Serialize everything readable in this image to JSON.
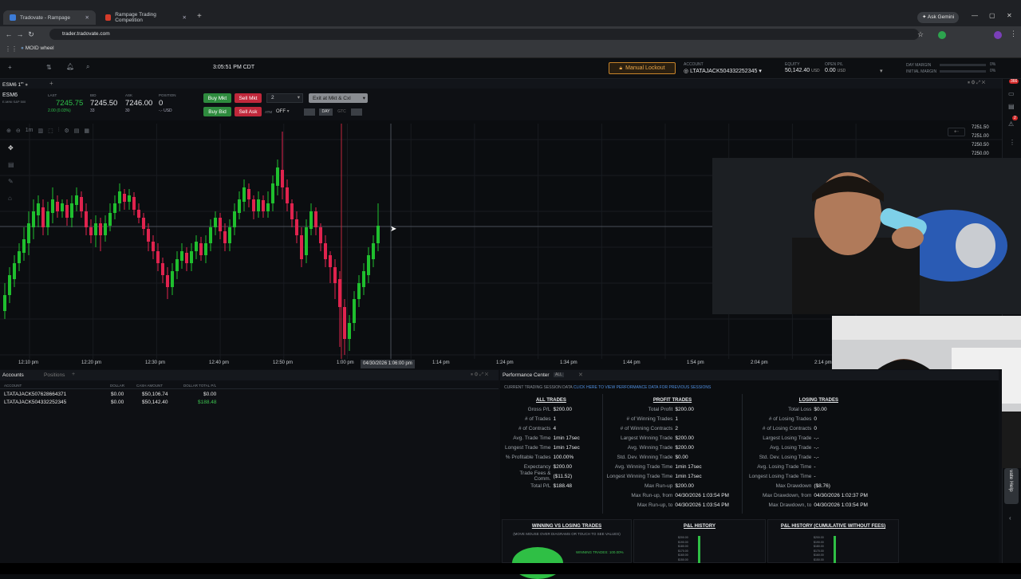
{
  "browser": {
    "tabs": [
      {
        "title": "Tradovate - Rampage",
        "active": true
      },
      {
        "title": "Rampage Trading Competition",
        "active": false
      }
    ],
    "new_tab": "+",
    "ask_gemini": "Ask Gemini",
    "url": "trader.tradovate.com",
    "bookmark": "MOID wheel"
  },
  "app": {
    "time": "3:05:51 PM CDT",
    "manual_lockout": "Manual Lockout",
    "account_label": "ACCOUNT",
    "account_value": "LTATAJACK504332252345",
    "equity_label": "EQUITY",
    "equity_value": "50,142.40",
    "equity_unit": "USD",
    "open_pl_label": "OPEN P/L",
    "open_pl_value": "0.00",
    "open_pl_unit": "USD",
    "day_margin_label": "DAY MARGIN",
    "initial_margin_label": "INITIAL MARGIN",
    "day_margin_pct": "0%",
    "initial_margin_pct": "0%",
    "notif_count": "366",
    "notif_count2": "2"
  },
  "symbol_tab": "ESM6 1",
  "quote": {
    "symbol": "ESM6",
    "desc": "E-MINI S&P 500",
    "last_label": "LAST",
    "last": "7245.75",
    "change": "2.00 (0.03%)",
    "bid_label": "BID",
    "bid": "7245.50",
    "bid_size": "33",
    "ask_label": "ASK",
    "ask": "7246.00",
    "ask_size": "30",
    "position_label": "POSITION",
    "position": "0",
    "position_sub": "-.- USD"
  },
  "order": {
    "buy_mkt": "Buy Mkt",
    "sell_mkt": "Sell Mkt",
    "qty": "2",
    "exit": "Exit at Mkt & Cxl",
    "buy_bid": "Buy Bid",
    "sell_ask": "Sell Ask",
    "atm_label": "ATM",
    "atm_value": "OFF",
    "day": "DAY",
    "gtc": "GTC"
  },
  "chart": {
    "interval": "1m",
    "price_labels": [
      "7251.50",
      "7251.00",
      "7250.50",
      "7250.00"
    ],
    "time_labels": [
      "12:10 pm",
      "12:20 pm",
      "12:30 pm",
      "12:40 pm",
      "12:50 pm",
      "1:00 pm",
      "1:14 pm",
      "1:24 pm",
      "1:34 pm",
      "1:44 pm",
      "1:54 pm",
      "2:04 pm",
      "2:14 pm"
    ],
    "crosshair_time": "04/30/2026 1:06:00 pm",
    "colors": {
      "up": "#1fbf2e",
      "down": "#e0234e"
    }
  },
  "accounts": {
    "tabs": [
      "Accounts",
      "Positions"
    ],
    "headers": [
      "ACCOUNT",
      "DOLLAR",
      "CASH AMOUNT",
      "DOLLAR TOTAL P/L"
    ],
    "rows": [
      {
        "account": "LTATAJACK507628664371",
        "dollar": "$0.00",
        "cash": "$50,106.74",
        "pl": "$0.00"
      },
      {
        "account": "LTATAJACK504332252345",
        "dollar": "$0.00",
        "cash": "$50,142.40",
        "pl": "$188.48"
      }
    ]
  },
  "perf": {
    "title": "Performance Center",
    "badge": "ALL",
    "banner_a": "CURRENT TRADING SESSION DATA",
    "banner_b": "CLICK HERE TO VIEW PERFORMANCE DATA FOR PREVIOUS SESSIONS",
    "all_trades": {
      "title": "ALL TRADES",
      "rows": [
        {
          "k": "Gross P/L",
          "v": "$200.00"
        },
        {
          "k": "# of Trades",
          "v": "1"
        },
        {
          "k": "# of Contracts",
          "v": "4"
        },
        {
          "k": "Avg. Trade Time",
          "v": "1min 17sec"
        },
        {
          "k": "Longest Trade Time",
          "v": "1min 17sec"
        },
        {
          "k": "% Profitable Trades",
          "v": "100.00%"
        },
        {
          "k": "Expectancy",
          "v": "$200.00"
        },
        {
          "k": "Trade Fees & Comm.",
          "v": "($11.52)"
        },
        {
          "k": "Total P/L",
          "v": "$188.48"
        }
      ]
    },
    "profit_trades": {
      "title": "PROFIT TRADES",
      "rows": [
        {
          "k": "Total Profit",
          "v": "$200.00"
        },
        {
          "k": "# of Winning Trades",
          "v": "1"
        },
        {
          "k": "# of Winning Contracts",
          "v": "2"
        },
        {
          "k": "Largest Winning Trade",
          "v": "$200.00"
        },
        {
          "k": "Avg. Winning Trade",
          "v": "$200.00"
        },
        {
          "k": "Std. Dev. Winning Trade",
          "v": "$0.00"
        },
        {
          "k": "Avg. Winning Trade Time",
          "v": "1min 17sec"
        },
        {
          "k": "Longest Winning Trade Time",
          "v": "1min 17sec"
        },
        {
          "k": "Max Run-up",
          "v": "$200.00"
        },
        {
          "k": "Max Run-up, from",
          "v": "04/30/2026 1:03:54 PM"
        },
        {
          "k": "Max Run-up, to",
          "v": "04/30/2026 1:03:54 PM"
        }
      ]
    },
    "losing_trades": {
      "title": "LOSING TRADES",
      "rows": [
        {
          "k": "Total Loss",
          "v": "$0.00"
        },
        {
          "k": "# of Losing Trades",
          "v": "0"
        },
        {
          "k": "# of Losing Contracts",
          "v": "0"
        },
        {
          "k": "Largest Losing Trade",
          "v": "-.-"
        },
        {
          "k": "Avg. Losing Trade",
          "v": "-.-"
        },
        {
          "k": "Std. Dev. Losing Trade",
          "v": "-.-"
        },
        {
          "k": "Avg. Losing Trade Time",
          "v": "-"
        },
        {
          "k": "Longest Losing Trade Time",
          "v": "-"
        },
        {
          "k": "Max Drawdown",
          "v": "($8.76)"
        },
        {
          "k": "Max Drawdown, from",
          "v": "04/30/2026 1:02:37 PM"
        },
        {
          "k": "Max Drawdown, to",
          "v": "04/30/2026 1:03:54 PM"
        }
      ]
    },
    "win_vs_lose_title": "WINNING VS LOSING TRADES",
    "win_vs_lose_sub": "(MOVE MOUSE OVER DIAGRAMS OR TOUCH TO SEE VALUES)",
    "winning_pct": "WINNING TRADES: 100.00%",
    "pl_history_title": "P&L HISTORY",
    "pl_history_cum_title": "P&L HISTORY (CUMULATIVE WITHOUT FEES)",
    "y_labels": [
      "$200.00",
      "$190.00",
      "$180.00",
      "$170.00",
      "$160.00",
      "$150.00"
    ]
  },
  "help_tab": "Tradovate Help"
}
